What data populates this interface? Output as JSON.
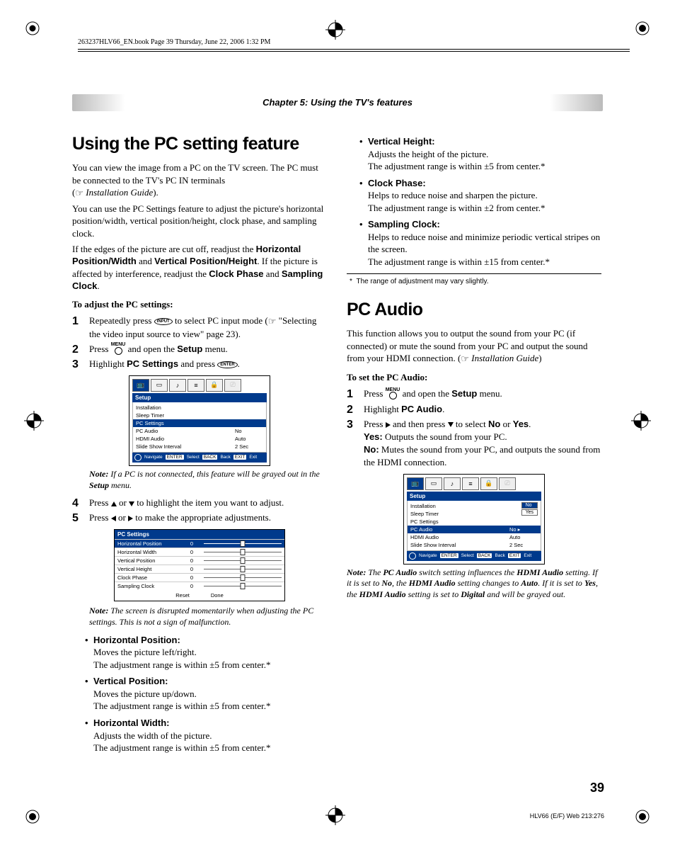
{
  "meta": {
    "header_line": "263237HLV66_EN.book  Page 39  Thursday, June 22, 2006  1:32 PM",
    "chapter": "Chapter 5: Using the TV's features",
    "page_number": "39",
    "footer_code": "HLV66 (E/F) Web 213:276"
  },
  "left": {
    "h1": "Using the PC setting feature",
    "p1": "You can view the image from a PC on the TV screen. The PC must be connected to the TV's PC IN terminals",
    "p1_ref": "Installation Guide",
    "p2": "You can use the PC Settings feature to adjust the picture's horizontal position/width, vertical position/height, clock phase, and sampling clock.",
    "p3a": "If the edges of the picture are cut off, readjust the ",
    "p3b": "Horizontal Position/Width",
    "p3c": " and ",
    "p3d": "Vertical Position/Height",
    "p3e": ". If the picture is affected by interference, readjust the ",
    "p3f": "Clock Phase",
    "p3g": " and ",
    "p3h": "Sampling Clock",
    "p3i": ".",
    "sub1": "To adjust the PC settings:",
    "s1a": "Repeatedly press ",
    "s1_btn": "INPUT",
    "s1b": " to select PC input mode (",
    "s1c": " \"Selecting the video input source to view\" page 23).",
    "s2a": "Press ",
    "s2_btn_top": "MENU",
    "s2b": " and open the ",
    "s2c": "Setup",
    "s2d": " menu.",
    "s3a": "Highlight ",
    "s3b": "PC Settings",
    "s3c": " and press ",
    "s3_btn": "ENTER",
    "s3d": ".",
    "osd1": {
      "title": "Setup",
      "rows": [
        {
          "l": "Installation",
          "r": ""
        },
        {
          "l": "Sleep Timer",
          "r": ""
        },
        {
          "l": "PC Settings",
          "r": "",
          "sel": true
        },
        {
          "l": "PC Audio",
          "r": "No"
        },
        {
          "l": "HDMI Audio",
          "r": "Auto"
        },
        {
          "l": "Slide Show Interval",
          "r": "2 Sec"
        }
      ],
      "footer": {
        "nav": "Navigate",
        "k1": "ENTER",
        "a1": "Select",
        "k2": "BACK",
        "a2": "Back",
        "k3": "EXIT",
        "a3": "Exit"
      }
    },
    "note1a": "If a PC is not connected, this feature will be grayed out in the ",
    "note1b": "Setup",
    "note1c": " menu.",
    "s4a": "Press ",
    "s4b": " or ",
    "s4c": " to highlight the item you want to adjust.",
    "s5a": "Press ",
    "s5b": " or ",
    "s5c": " to make the appropriate adjustments.",
    "pcset": {
      "title": "PC Settings",
      "rows": [
        {
          "l": "Horizontal Position",
          "v": "0",
          "sel": true
        },
        {
          "l": "Horizontal Width",
          "v": "0"
        },
        {
          "l": "Vertical Position",
          "v": "0"
        },
        {
          "l": "Vertical Height",
          "v": "0"
        },
        {
          "l": "Clock Phase",
          "v": "0"
        },
        {
          "l": "Sampling Clock",
          "v": "0"
        }
      ],
      "btn_reset": "Reset",
      "btn_done": "Done"
    },
    "note2": "The screen is disrupted momentarily when adjusting the PC settings. This is not a sign of malfunction.",
    "bullets": [
      {
        "t": "Horizontal Position:",
        "l1": "Moves the picture left/right.",
        "l2": "The adjustment range is within ±5 from center.*"
      },
      {
        "t": "Vertical Position:",
        "l1": "Moves the picture up/down.",
        "l2": "The adjustment range is within ±5 from center.*"
      },
      {
        "t": "Horizontal Width:",
        "l1": "Adjusts the width of the picture.",
        "l2": "The adjustment range is within ±5 from center.*"
      }
    ]
  },
  "right": {
    "bullets_top": [
      {
        "t": "Vertical Height:",
        "l1": "Adjusts the height of the picture.",
        "l2": "The adjustment range is within ±5 from center.*"
      },
      {
        "t": "Clock Phase:",
        "l1": "Helps to reduce noise and sharpen the picture.",
        "l2": "The adjustment range is within ±2 from center.*"
      },
      {
        "t": "Sampling Clock:",
        "l1": "Helps to reduce noise and minimize periodic vertical stripes on the screen.",
        "l2": "The adjustment range is within ±15 from center.*"
      }
    ],
    "footnote_mark": "*",
    "footnote": "The range of adjustment may vary slightly.",
    "h1": "PC Audio",
    "p1a": "This function allows you to output the sound from your PC (if connected) or mute the sound from your PC and output the sound from your HDMI connection. (",
    "p1_ref": "Installation Guide",
    "p1b": ")",
    "sub1": "To set the PC Audio:",
    "s1a": "Press ",
    "s1_btn_top": "MENU",
    "s1b": " and open the ",
    "s1c": "Setup",
    "s1d": " menu.",
    "s2a": "Highlight ",
    "s2b": "PC Audio",
    "s2c": ".",
    "s3a": "Press ",
    "s3b": " and then press ",
    "s3c": " to select ",
    "s3d": "No",
    "s3e": " or ",
    "s3f": "Yes",
    "s3g": ".",
    "s3_yes_l": "Yes:",
    "s3_yes": " Outputs the sound from your PC.",
    "s3_no_l": "No:",
    "s3_no": " Mutes the sound from your PC, and outputs the sound from the HDMI connection.",
    "osd2": {
      "title": "Setup",
      "rows": [
        {
          "l": "Installation",
          "r": ""
        },
        {
          "l": "Sleep Timer",
          "r": "",
          "opts": [
            "No",
            "Yes"
          ],
          "opt_sel": 0
        },
        {
          "l": "PC Settings",
          "r": ""
        },
        {
          "l": "PC Audio",
          "r": "No",
          "sel": true
        },
        {
          "l": "HDMI Audio",
          "r": "Auto"
        },
        {
          "l": "Slide Show Interval",
          "r": "2 Sec"
        }
      ],
      "footer": {
        "nav": "Navigate",
        "k1": "ENTER",
        "a1": "Select",
        "k2": "BACK",
        "a2": "Back",
        "k3": "EXIT",
        "a3": "Exit"
      }
    },
    "note_l": "Note:",
    "note_a": " The ",
    "note_b": "PC Audio",
    "note_c": " switch setting influences the ",
    "note_d": "HDMI Audio",
    "note_e": " setting. If it is set to ",
    "note_f": "No",
    "note_g": ", the ",
    "note_h": "HDMI Audio",
    "note_i": " setting changes to ",
    "note_j": "Auto",
    "note_k": ". If it is set to ",
    "note_l2": "Yes",
    "note_m": ", the ",
    "note_n": "HDMI Audio",
    "note_o": " setting is set to ",
    "note_p": "Digital",
    "note_q": " and will be grayed out."
  },
  "labels": {
    "note": "Note:"
  }
}
